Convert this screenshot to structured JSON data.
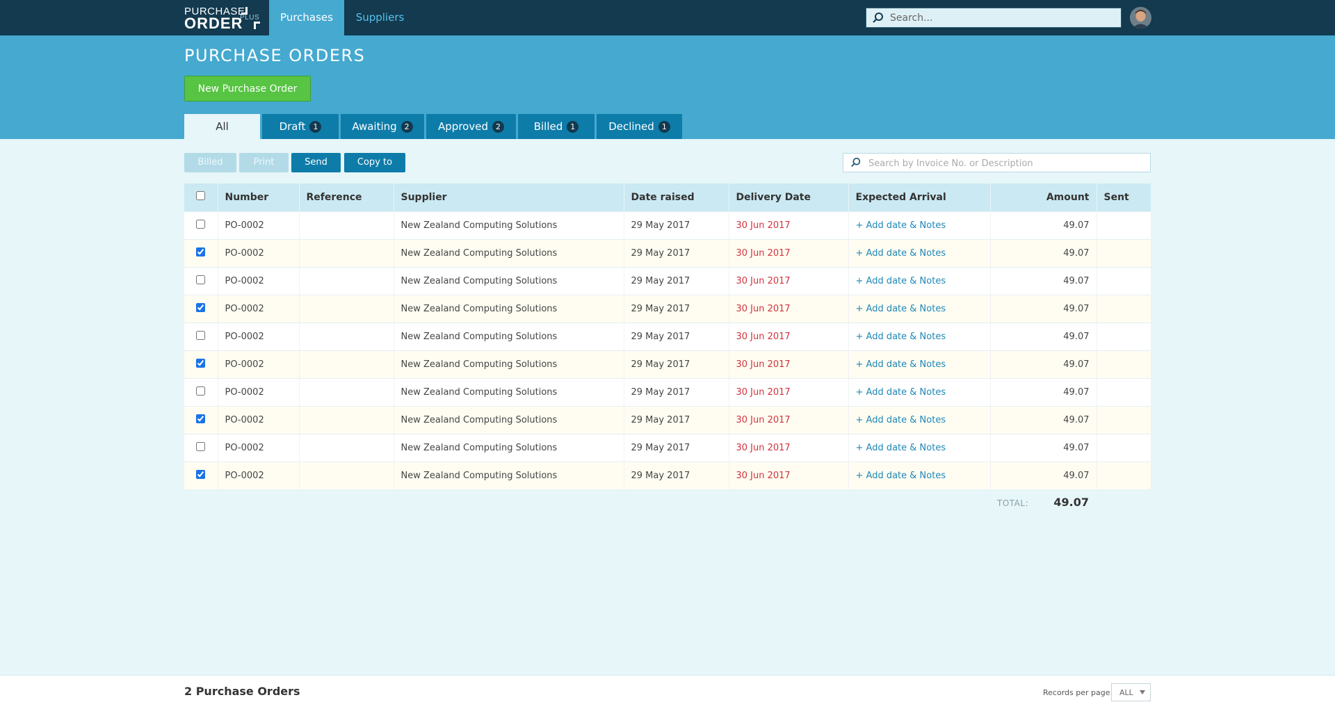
{
  "app": {
    "logo_line1": "PURCHASE",
    "logo_line2": "ORDER",
    "logo_plus": "PLUS"
  },
  "nav": {
    "tabs": [
      {
        "label": "Purchases",
        "active": true
      },
      {
        "label": "Suppliers",
        "active": false
      }
    ]
  },
  "search": {
    "placeholder": "Search..."
  },
  "page": {
    "title": "PURCHASE ORDERS",
    "new_button": "New Purchase Order"
  },
  "status_tabs": [
    {
      "label": "All",
      "count": ""
    },
    {
      "label": "Draft",
      "count": "1"
    },
    {
      "label": "Awaiting",
      "count": "2"
    },
    {
      "label": "Approved",
      "count": "2"
    },
    {
      "label": "Billed",
      "count": "1"
    },
    {
      "label": "Declined",
      "count": "1"
    }
  ],
  "toolbar": {
    "billed": "Billed",
    "print": "Print",
    "send": "Send",
    "copy_to": "Copy to",
    "search_placeholder": "Search by Invoice No. or Description"
  },
  "table": {
    "columns": [
      "Number",
      "Reference",
      "Supplier",
      "Date raised",
      "Delivery Date",
      "Expected Arrival",
      "Amount",
      "Sent"
    ],
    "rows": [
      {
        "checked": false,
        "number": "PO-0002",
        "reference": "",
        "supplier": "New Zealand Computing Solutions",
        "date_raised": "29 May 2017",
        "delivery_date": "30 Jun 2017",
        "expected_arrival": "+ Add date & Notes",
        "amount": "49.07",
        "sent": ""
      },
      {
        "checked": true,
        "number": "PO-0002",
        "reference": "",
        "supplier": "New Zealand Computing Solutions",
        "date_raised": "29 May 2017",
        "delivery_date": "30 Jun 2017",
        "expected_arrival": "+ Add date & Notes",
        "amount": "49.07",
        "sent": ""
      },
      {
        "checked": false,
        "number": "PO-0002",
        "reference": "",
        "supplier": "New Zealand Computing Solutions",
        "date_raised": "29 May 2017",
        "delivery_date": "30 Jun 2017",
        "expected_arrival": "+ Add date & Notes",
        "amount": "49.07",
        "sent": ""
      },
      {
        "checked": true,
        "number": "PO-0002",
        "reference": "",
        "supplier": "New Zealand Computing Solutions",
        "date_raised": "29 May 2017",
        "delivery_date": "30 Jun 2017",
        "expected_arrival": "+ Add date & Notes",
        "amount": "49.07",
        "sent": ""
      },
      {
        "checked": false,
        "number": "PO-0002",
        "reference": "",
        "supplier": "New Zealand Computing Solutions",
        "date_raised": "29 May 2017",
        "delivery_date": "30 Jun 2017",
        "expected_arrival": "+ Add date & Notes",
        "amount": "49.07",
        "sent": ""
      },
      {
        "checked": true,
        "number": "PO-0002",
        "reference": "",
        "supplier": "New Zealand Computing Solutions",
        "date_raised": "29 May 2017",
        "delivery_date": "30 Jun 2017",
        "expected_arrival": "+ Add date & Notes",
        "amount": "49.07",
        "sent": ""
      },
      {
        "checked": false,
        "number": "PO-0002",
        "reference": "",
        "supplier": "New Zealand Computing Solutions",
        "date_raised": "29 May 2017",
        "delivery_date": "30 Jun 2017",
        "expected_arrival": "+ Add date & Notes",
        "amount": "49.07",
        "sent": ""
      },
      {
        "checked": true,
        "number": "PO-0002",
        "reference": "",
        "supplier": "New Zealand Computing Solutions",
        "date_raised": "29 May 2017",
        "delivery_date": "30 Jun 2017",
        "expected_arrival": "+ Add date & Notes",
        "amount": "49.07",
        "sent": ""
      },
      {
        "checked": false,
        "number": "PO-0002",
        "reference": "",
        "supplier": "New Zealand Computing Solutions",
        "date_raised": "29 May 2017",
        "delivery_date": "30 Jun 2017",
        "expected_arrival": "+ Add date & Notes",
        "amount": "49.07",
        "sent": ""
      },
      {
        "checked": true,
        "number": "PO-0002",
        "reference": "",
        "supplier": "New Zealand Computing Solutions",
        "date_raised": "29 May 2017",
        "delivery_date": "30 Jun 2017",
        "expected_arrival": "+ Add date & Notes",
        "amount": "49.07",
        "sent": ""
      }
    ],
    "total_label": "TOTAL:",
    "total_value": "49.07"
  },
  "footer": {
    "count_text": "2 Purchase Orders",
    "records_label": "Records per page:",
    "records_value": "ALL"
  },
  "colors": {
    "navbar": "#133a4f",
    "header": "#45a9d0",
    "tab_bg": "#0e7ca9",
    "new_button": "#57c443",
    "delivery_date": "#d0323c",
    "link": "#1f87b6"
  },
  "icons": {
    "search": "search-icon",
    "avatar": "user-avatar",
    "dropdown": "chevron-down-icon"
  }
}
